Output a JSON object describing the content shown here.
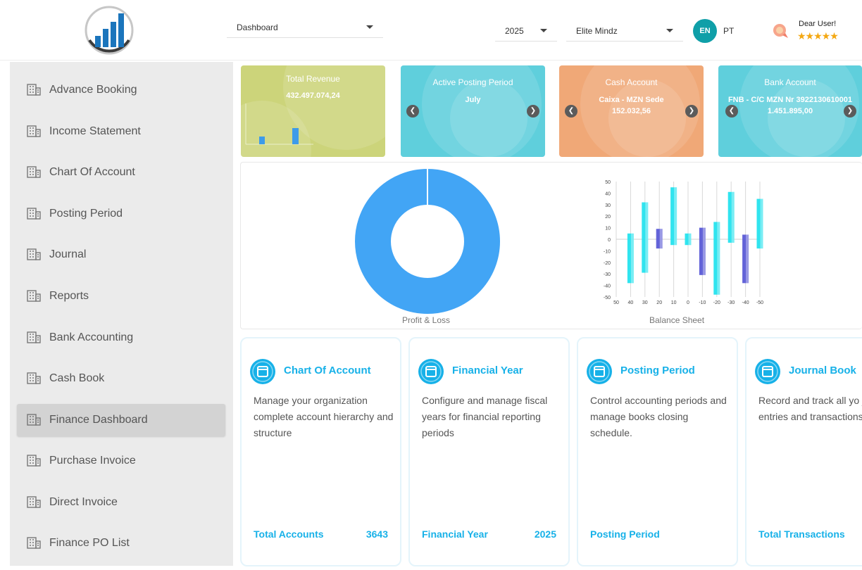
{
  "header": {
    "nav_select": "Dashboard",
    "year_select": "2025",
    "company_select": "Elite Mindz",
    "lang_active": "EN",
    "lang_other": "PT",
    "greeting": "Dear User!",
    "rating_stars": "★★★★★"
  },
  "sidebar": {
    "items": [
      {
        "label": "Advance Booking"
      },
      {
        "label": "Income Statement"
      },
      {
        "label": "Chart Of Account"
      },
      {
        "label": "Posting Period"
      },
      {
        "label": "Journal"
      },
      {
        "label": "Reports"
      },
      {
        "label": "Bank Accounting"
      },
      {
        "label": "Cash Book"
      },
      {
        "label": "Finance Dashboard",
        "active": true
      },
      {
        "label": "Purchase Invoice"
      },
      {
        "label": "Direct Invoice"
      },
      {
        "label": "Finance PO List"
      }
    ]
  },
  "kpis": {
    "revenue": {
      "title": "Total Revenue",
      "value": "432.497.074,24",
      "color": "#ccd47a"
    },
    "posting": {
      "title": "Active Posting Period",
      "value": "July",
      "color": "#5fcfdc"
    },
    "cash": {
      "title": "Cash Account",
      "line1": "Caixa - MZN Sede",
      "value": "152.032,56",
      "color": "#f0a877"
    },
    "bank": {
      "title": "Bank Account",
      "line1": "FNB - C/C MZN Nr 3922130610001",
      "value": "1.451.895,00",
      "color": "#5fcfdc"
    }
  },
  "charts": {
    "pie_caption": "Profit & Loss",
    "bar_caption": "Balance Sheet"
  },
  "chart_data": [
    {
      "type": "pie",
      "title": "",
      "labels": [],
      "values": [
        100
      ],
      "note_colors": [
        "#42a5f5"
      ]
    },
    {
      "type": "bar",
      "title": "",
      "xlabel": "",
      "ylabel": "",
      "x_tick_labels": [
        "50",
        "40",
        "30",
        "20",
        "10",
        "0",
        "-10",
        "-20",
        "-30",
        "-40",
        "-50"
      ],
      "ylim": [
        -50,
        50
      ],
      "y_ticks": [
        50,
        40,
        30,
        20,
        10,
        0,
        -10,
        -20,
        -30,
        -40,
        -50
      ],
      "grid": true,
      "floating_bars": [
        {
          "x": 1,
          "low": -38,
          "high": 5,
          "color": "#25e3ee"
        },
        {
          "x": 2,
          "low": -29,
          "high": 32,
          "color": "#25e3ee"
        },
        {
          "x": 3,
          "low": -8,
          "high": 9,
          "color": "#5b5bd6"
        },
        {
          "x": 4,
          "low": -5,
          "high": 45,
          "color": "#25e3ee"
        },
        {
          "x": 5,
          "low": -5,
          "high": 5,
          "color": "#25e3ee"
        },
        {
          "x": 6,
          "low": -31,
          "high": 10,
          "color": "#5b5bd6"
        },
        {
          "x": 7,
          "low": -48,
          "high": 15,
          "color": "#25e3ee"
        },
        {
          "x": 8,
          "low": -3,
          "high": 41,
          "color": "#25e3ee"
        },
        {
          "x": 9,
          "low": -38,
          "high": 4,
          "color": "#5b5bd6"
        },
        {
          "x": 10,
          "low": -8,
          "high": 35,
          "color": "#25e3ee"
        }
      ]
    }
  ],
  "cards": [
    {
      "title": "Chart Of Account",
      "desc": "Manage your organization complete account hierarchy and structure",
      "foot_label": "Total Accounts",
      "foot_value": "3643"
    },
    {
      "title": "Financial Year",
      "desc": "Configure and manage fiscal years for financial reporting periods",
      "foot_label": "Financial Year",
      "foot_value": "2025"
    },
    {
      "title": "Posting Period",
      "desc": "Control accounting periods and manage books closing schedule.",
      "foot_label": "Posting Period",
      "foot_value": ""
    },
    {
      "title": "Journal Book",
      "desc": "Record and track all yo journal entries and transactions.",
      "foot_label": "Total Transactions",
      "foot_value": ""
    }
  ],
  "colors": {
    "accent": "#17b1e8",
    "lang_badge": "#0f9fa8",
    "donut": "#42a5f5",
    "bar_cyan": "#25e3ee",
    "bar_indigo": "#5b5bd6"
  }
}
